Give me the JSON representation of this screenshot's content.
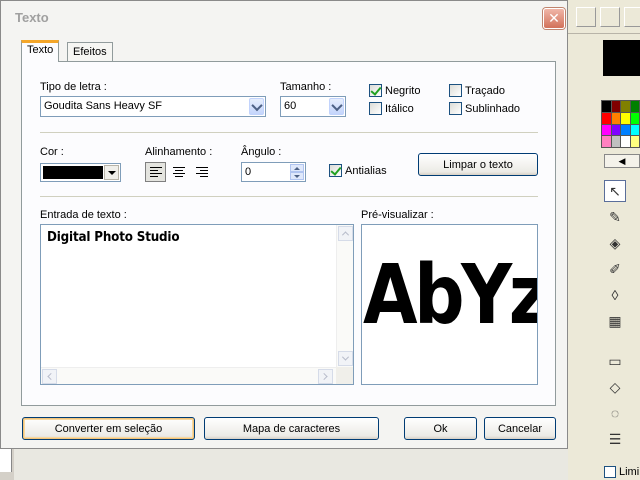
{
  "dialog": {
    "title": "Texto",
    "close_icon": "close-icon",
    "tabs": [
      {
        "label": "Texto",
        "active": true
      },
      {
        "label": "Efeitos",
        "active": false
      }
    ]
  },
  "font": {
    "label": "Tipo de letra :",
    "value": "Goudita Sans Heavy SF"
  },
  "size": {
    "label": "Tamanho :",
    "value": "60"
  },
  "styles": {
    "bold": {
      "label": "Negrito",
      "checked": true
    },
    "italic": {
      "label": "Itálico",
      "checked": false
    },
    "outline": {
      "label": "Traçado",
      "checked": false
    },
    "underline": {
      "label": "Sublinhado",
      "checked": false
    }
  },
  "color": {
    "label": "Cor :",
    "value": "#000000"
  },
  "alignment": {
    "label": "Alinhamento :",
    "options": [
      "left",
      "center",
      "right"
    ],
    "selected": "left"
  },
  "angle": {
    "label": "Ângulo :",
    "value": "0"
  },
  "antialias": {
    "label": "Antialias",
    "checked": true
  },
  "clear_button": "Limpar o texto",
  "text_input": {
    "label": "Entrada de texto :",
    "value": "Digital Photo Studio"
  },
  "preview": {
    "label": "Pré-visualizar :",
    "text": "AbYz"
  },
  "buttons": {
    "convert": "Converter em seleção",
    "charmap": "Mapa de caracteres",
    "ok": "Ok",
    "cancel": "Cancelar"
  },
  "side_panel": {
    "palette_colors": [
      "#000000",
      "#800000",
      "#808000",
      "#008000",
      "#ff0000",
      "#ff8000",
      "#ffff00",
      "#00ff00",
      "#ff00ff",
      "#8000ff",
      "#0080ff",
      "#00ffff",
      "#ff80c0",
      "#c0c0c0",
      "#ffffff",
      "#ffff80"
    ],
    "limit_label": "Limi"
  }
}
